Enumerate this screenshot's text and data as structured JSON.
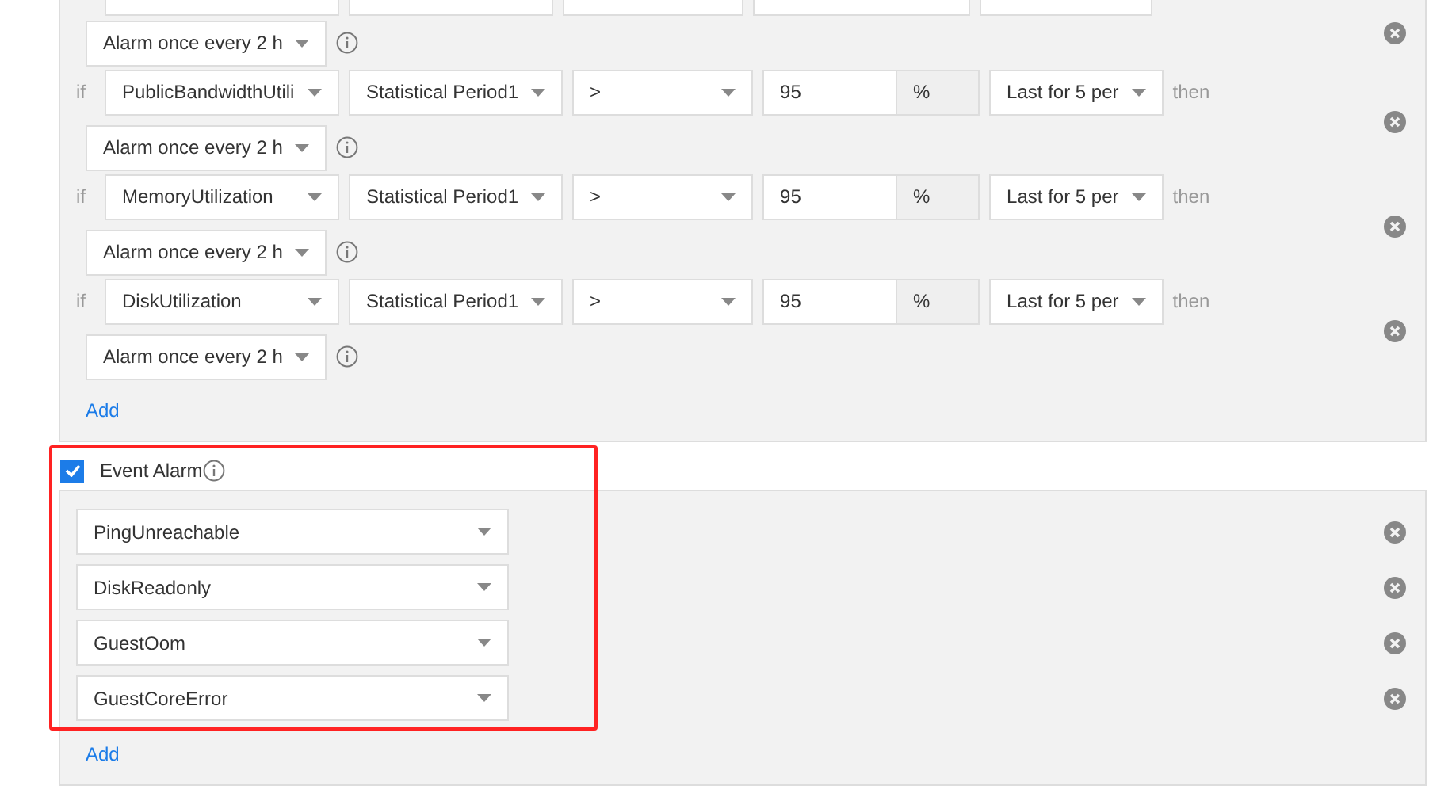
{
  "threshold_rules": [
    {
      "kind": "partial",
      "alarm_frequency": "Alarm once every 2 h"
    },
    {
      "kind": "full",
      "if_label": "if",
      "metric": "PublicBandwidthUtili",
      "period": "Statistical Period1",
      "operator": ">",
      "value": "95",
      "unit": "%",
      "duration": "Last for 5 per",
      "then_label": "then",
      "alarm_frequency": "Alarm once every 2 h"
    },
    {
      "kind": "full",
      "if_label": "if",
      "metric": "MemoryUtilization",
      "period": "Statistical Period1",
      "operator": ">",
      "value": "95",
      "unit": "%",
      "duration": "Last for 5 per",
      "then_label": "then",
      "alarm_frequency": "Alarm once every 2 h"
    },
    {
      "kind": "full",
      "if_label": "if",
      "metric": "DiskUtilization",
      "period": "Statistical Period1",
      "operator": ">",
      "value": "95",
      "unit": "%",
      "duration": "Last for 5 per",
      "then_label": "then",
      "alarm_frequency": "Alarm once every 2 h"
    }
  ],
  "threshold_add": "Add",
  "event_alarm": {
    "checked": true,
    "label": "Event Alarm",
    "highlighted": true,
    "events": [
      {
        "name": "PingUnreachable"
      },
      {
        "name": "DiskReadonly"
      },
      {
        "name": "GuestOom"
      },
      {
        "name": "GuestCoreError"
      }
    ],
    "add": "Add"
  }
}
